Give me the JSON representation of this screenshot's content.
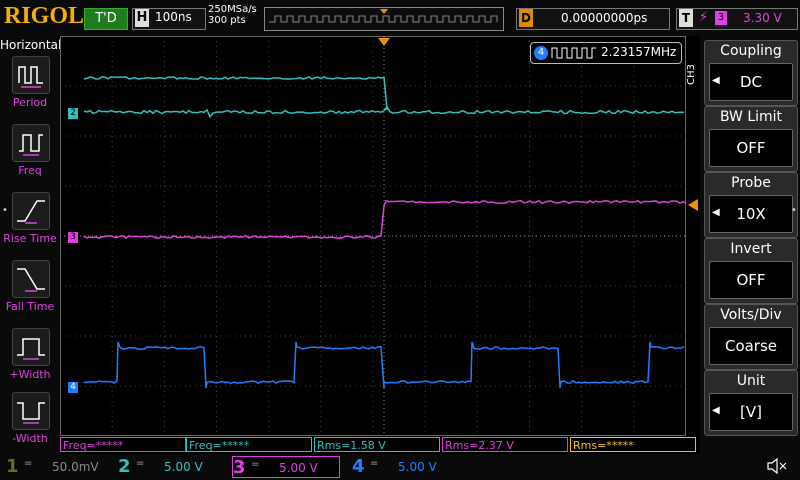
{
  "brand": "RIGOL",
  "status": "T'D",
  "timebase": {
    "key": "H",
    "value": "100ns"
  },
  "sample": {
    "rate": "250MSa/s",
    "points": "300  pts"
  },
  "delay": {
    "key": "D",
    "value": "0.00000000ps"
  },
  "trigger": {
    "key": "T",
    "edge": "⚡",
    "source": "3",
    "level": "3.30 V"
  },
  "left_menu": {
    "title": "Horizontal",
    "items": [
      {
        "label": "Period",
        "icon": "period-icon"
      },
      {
        "label": "Freq",
        "icon": "freq-icon"
      },
      {
        "label": "Rise Time",
        "icon": "rise-time-icon"
      },
      {
        "label": "Fall Time",
        "icon": "fall-time-icon"
      },
      {
        "label": "+Width",
        "icon": "positive-width-icon"
      },
      {
        "label": "-Width",
        "icon": "negative-width-icon"
      }
    ]
  },
  "freq_counter": {
    "channel": "4",
    "value": "2.23157MHz"
  },
  "channel_markers": {
    "ch2": "2",
    "ch3": "3",
    "ch4": "4"
  },
  "right_menu": {
    "channel_tag": "CH3",
    "items": [
      {
        "title": "Coupling",
        "value": "DC",
        "has_arrow": true
      },
      {
        "title": "BW Limit",
        "value": "OFF",
        "has_arrow": false
      },
      {
        "title": "Probe",
        "value": "10X",
        "has_arrow": true
      },
      {
        "title": "Invert",
        "value": "OFF",
        "has_arrow": false
      },
      {
        "title": "Volts/Div",
        "value": "Coarse",
        "has_arrow": false
      },
      {
        "title": "Unit",
        "value": "[V]",
        "has_arrow": true
      }
    ]
  },
  "measurements": [
    {
      "text": "Freq=*****",
      "color": "#e040e0"
    },
    {
      "text": "Freq=*****",
      "color": "#2fc0c0"
    },
    {
      "text": "Rms=1.58 V",
      "color": "#2fc0c0"
    },
    {
      "text": "Rms=2.37 V",
      "color": "#e040e0"
    },
    {
      "text": "Rms=*****",
      "color": "#f0c020"
    }
  ],
  "channels": [
    {
      "num": "1",
      "coupling": "=",
      "scale": "50.0mV",
      "color": "#6a6a2a"
    },
    {
      "num": "2",
      "coupling": "=",
      "scale": "5.00 V",
      "color": "#2fc0c0"
    },
    {
      "num": "3",
      "coupling": "=",
      "scale": "5.00 V",
      "color": "#e040e0"
    },
    {
      "num": "4",
      "coupling": "=",
      "scale": "5.00 V",
      "color": "#1e7fff"
    }
  ],
  "colors": {
    "ch1": "#a0a030",
    "ch2": "#2fc0c0",
    "ch3": "#e040e0",
    "ch4": "#1e7fff",
    "trigger": "#f09000"
  }
}
